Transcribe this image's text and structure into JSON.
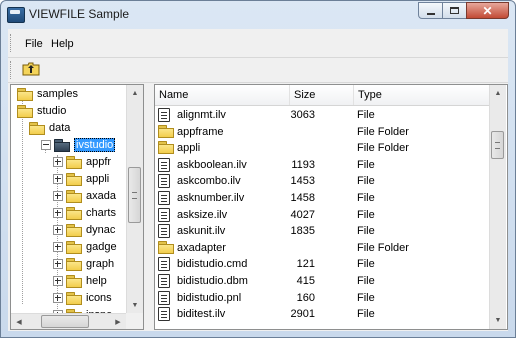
{
  "window": {
    "title": "VIEWFILE Sample"
  },
  "menu": {
    "file": "File",
    "help": "Help"
  },
  "tree": {
    "items": [
      {
        "label": "samples",
        "depth": 0
      },
      {
        "label": "studio",
        "depth": 0
      },
      {
        "label": "data",
        "depth": 1
      },
      {
        "label": "ivstudio",
        "depth": 2,
        "selected": true
      },
      {
        "label": "appfr",
        "depth": 3
      },
      {
        "label": "appli",
        "depth": 3
      },
      {
        "label": "axada",
        "depth": 3
      },
      {
        "label": "charts",
        "depth": 3
      },
      {
        "label": "dynac",
        "depth": 3
      },
      {
        "label": "gadge",
        "depth": 3
      },
      {
        "label": "graph",
        "depth": 3
      },
      {
        "label": "help",
        "depth": 3
      },
      {
        "label": "icons",
        "depth": 3
      },
      {
        "label": "inspe",
        "depth": 3
      }
    ]
  },
  "list": {
    "columns": [
      "Name",
      "Size",
      "Type"
    ],
    "rows": [
      {
        "name": "alignmt.ilv",
        "size": "3063",
        "type": "File",
        "icon": "document-icon"
      },
      {
        "name": "appframe",
        "size": "",
        "type": "File Folder",
        "icon": "folder-icon"
      },
      {
        "name": "appli",
        "size": "",
        "type": "File Folder",
        "icon": "folder-icon"
      },
      {
        "name": "askboolean.ilv",
        "size": "1193",
        "type": "File",
        "icon": "document-icon"
      },
      {
        "name": "askcombo.ilv",
        "size": "1453",
        "type": "File",
        "icon": "document-icon"
      },
      {
        "name": "asknumber.ilv",
        "size": "1458",
        "type": "File",
        "icon": "document-icon"
      },
      {
        "name": "asksize.ilv",
        "size": "4027",
        "type": "File",
        "icon": "document-icon"
      },
      {
        "name": "askunit.ilv",
        "size": "1835",
        "type": "File",
        "icon": "document-icon"
      },
      {
        "name": "axadapter",
        "size": "",
        "type": "File Folder",
        "icon": "folder-icon"
      },
      {
        "name": "bidistudio.cmd",
        "size": "121",
        "type": "File",
        "icon": "document-icon"
      },
      {
        "name": "bidistudio.dbm",
        "size": "415",
        "type": "File",
        "icon": "document-icon"
      },
      {
        "name": "bidistudio.pnl",
        "size": "160",
        "type": "File",
        "icon": "document-icon"
      },
      {
        "name": "biditest.ilv",
        "size": "2901",
        "type": "File",
        "icon": "document-icon"
      }
    ]
  }
}
